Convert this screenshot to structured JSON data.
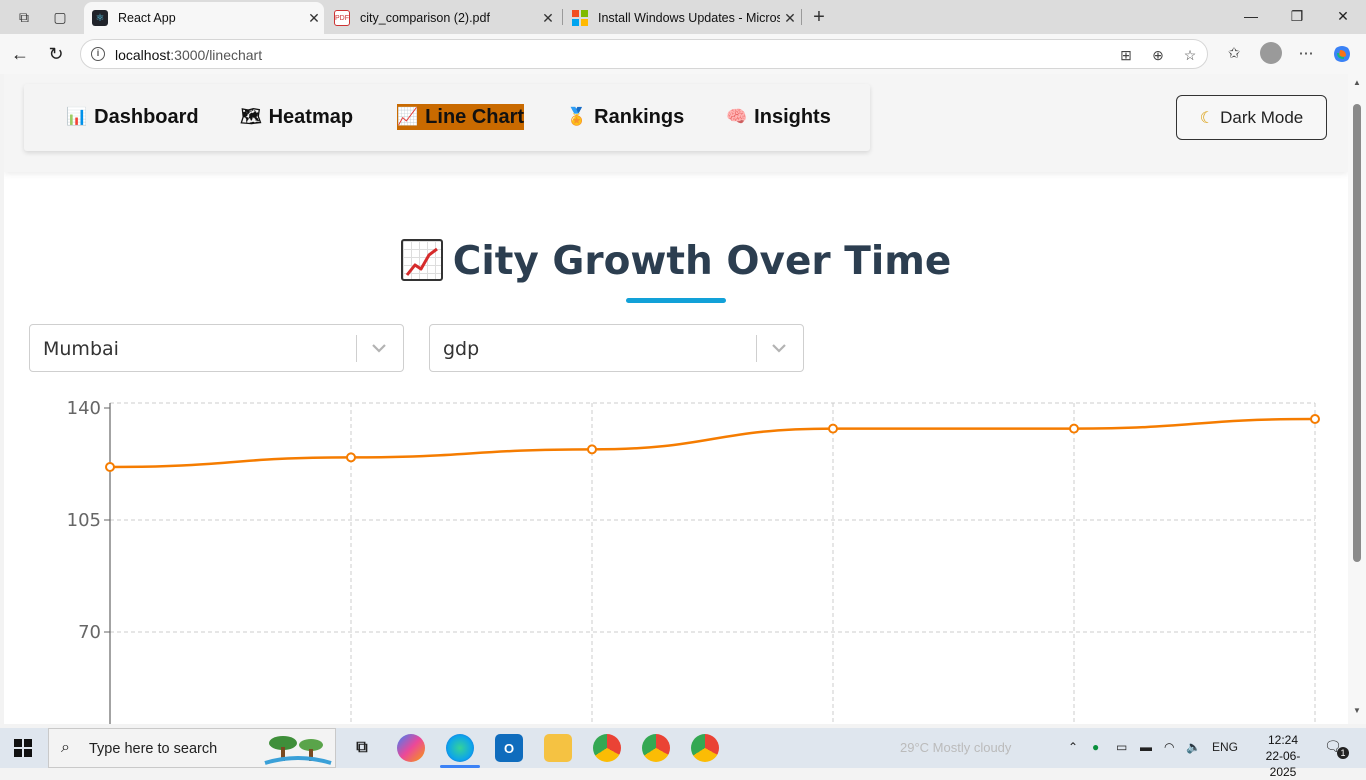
{
  "browser": {
    "tabs": [
      {
        "title": "React App",
        "active": true
      },
      {
        "title": "city_comparison (2).pdf",
        "active": false
      },
      {
        "title": "Install Windows Updates - Micros",
        "active": false
      }
    ],
    "url_host": "localhost",
    "url_path": ":3000/linechart"
  },
  "nav": {
    "links": [
      {
        "icon": "📊",
        "label": "Dashboard"
      },
      {
        "icon": "🗺",
        "label": "Heatmap"
      },
      {
        "icon": "📈",
        "label": "Line Chart"
      },
      {
        "icon": "🏅",
        "label": "Rankings"
      },
      {
        "icon": "🧠",
        "label": "Insights"
      }
    ],
    "active": "Line Chart",
    "dark_mode_label": "Dark Mode"
  },
  "page": {
    "title": "City Growth Over Time",
    "city_select": "Mumbai",
    "metric_select": "gdp"
  },
  "chart_data": {
    "type": "line",
    "series": [
      {
        "values": [
          120,
          123,
          125.5,
          132,
          132,
          135
        ],
        "color": "#f57c00"
      }
    ],
    "y_ticks": [
      "140",
      "105",
      "70"
    ],
    "ylim_visible": [
      35,
      140
    ],
    "grid": true,
    "point_count": 6
  },
  "taskbar": {
    "search_placeholder": "Type here to search",
    "weather": "29°C  Mostly cloudy",
    "lang": "ENG",
    "time": "12:24",
    "date": "22-06-2025",
    "notifications": "1"
  },
  "colors": {
    "accent_active_nav": "#c96a00",
    "title": "#2c3e50",
    "underline": "#12a1d8",
    "line": "#f57c00"
  }
}
